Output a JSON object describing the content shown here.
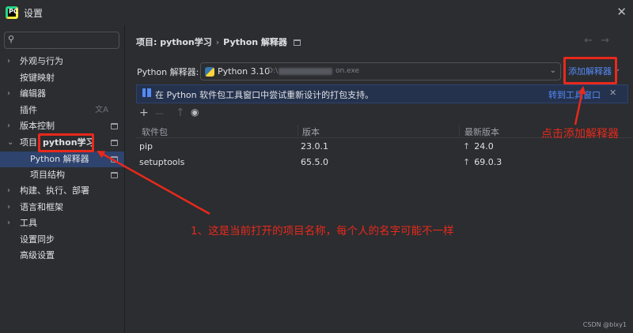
{
  "window": {
    "title": "设置",
    "logo_text": "PC"
  },
  "sidebar": {
    "search_placeholder": "",
    "items": [
      {
        "label": "外观与行为",
        "chevron": "›"
      },
      {
        "label": "按键映射"
      },
      {
        "label": "编辑器",
        "chevron": "›"
      },
      {
        "label": "插件",
        "icon": "translate-icon"
      },
      {
        "label": "版本控制",
        "chevron": "›",
        "icon": "project-scope-icon"
      },
      {
        "label": "项目:",
        "chevron": "⌄",
        "project_name": "python学习",
        "icon": "project-scope-icon"
      },
      {
        "label": "Python 解释器",
        "icon": "project-scope-icon",
        "selected": true
      },
      {
        "label": "项目结构",
        "icon": "project-scope-icon"
      },
      {
        "label": "构建、执行、部署",
        "chevron": "›"
      },
      {
        "label": "语言和框架",
        "chevron": "›"
      },
      {
        "label": "工具",
        "chevron": "›"
      },
      {
        "label": "设置同步"
      },
      {
        "label": "高级设置"
      }
    ]
  },
  "main": {
    "breadcrumb": {
      "project": "项目: python学习",
      "separator": "›",
      "page": "Python 解释器"
    },
    "interpreter": {
      "label": "Python 解释器:",
      "name": "Python 3.10",
      "path_prefix": "D:\\",
      "path_suffix": "on.exe",
      "add_label": "添加解释器"
    },
    "banner": {
      "message": "在 Python 软件包工具窗口中尝试重新设计的打包支持。",
      "link": "转到工具窗口",
      "close": "✕"
    },
    "toolbar": {
      "add": "+",
      "remove": "—",
      "upgrade": "↑",
      "show": "👁"
    },
    "table": {
      "columns": [
        "软件包",
        "版本",
        "最新版本"
      ],
      "rows": [
        {
          "package": "pip",
          "version": "23.0.1",
          "latest": "24.0"
        },
        {
          "package": "setuptools",
          "version": "65.5.0",
          "latest": "69.0.3"
        }
      ]
    }
  },
  "annotations": {
    "add_interpreter_note": "点击添加解释器",
    "project_name_note": "1、这是当前打开的项目名称，每个人的名字可能不一样",
    "color": "#e8291c"
  },
  "watermark": "CSDN @blxy1",
  "colors": {
    "accent": "#548af7",
    "selection": "#2e436e",
    "background": "#2b2d30",
    "annotation": "#e8291c"
  }
}
